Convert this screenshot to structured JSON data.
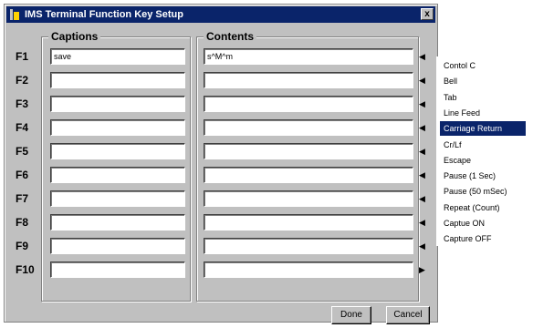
{
  "window": {
    "title": "IMS Terminal Function Key Setup",
    "close_label": "x"
  },
  "headers": {
    "captions": "Captions",
    "contents": "Contents"
  },
  "rows": [
    {
      "key": "F1",
      "caption": "save",
      "content": "s^M^m"
    },
    {
      "key": "F2",
      "caption": "",
      "content": ""
    },
    {
      "key": "F3",
      "caption": "",
      "content": ""
    },
    {
      "key": "F4",
      "caption": "",
      "content": ""
    },
    {
      "key": "F5",
      "caption": "",
      "content": ""
    },
    {
      "key": "F6",
      "caption": "",
      "content": ""
    },
    {
      "key": "F7",
      "caption": "",
      "content": ""
    },
    {
      "key": "F8",
      "caption": "",
      "content": ""
    },
    {
      "key": "F9",
      "caption": "",
      "content": ""
    },
    {
      "key": "F10",
      "caption": "",
      "content": ""
    }
  ],
  "buttons": {
    "done": "Done",
    "cancel": "Cancel"
  },
  "menu": {
    "items": [
      "Contol C",
      "Bell",
      "Tab",
      "Line Feed",
      "Carriage Return",
      "Cr/Lf",
      "Escape",
      "Pause (1 Sec)",
      "Pause (50 mSec)",
      "Repeat (Count)",
      "Captue ON",
      "Capture OFF"
    ],
    "selected_index": 4
  }
}
